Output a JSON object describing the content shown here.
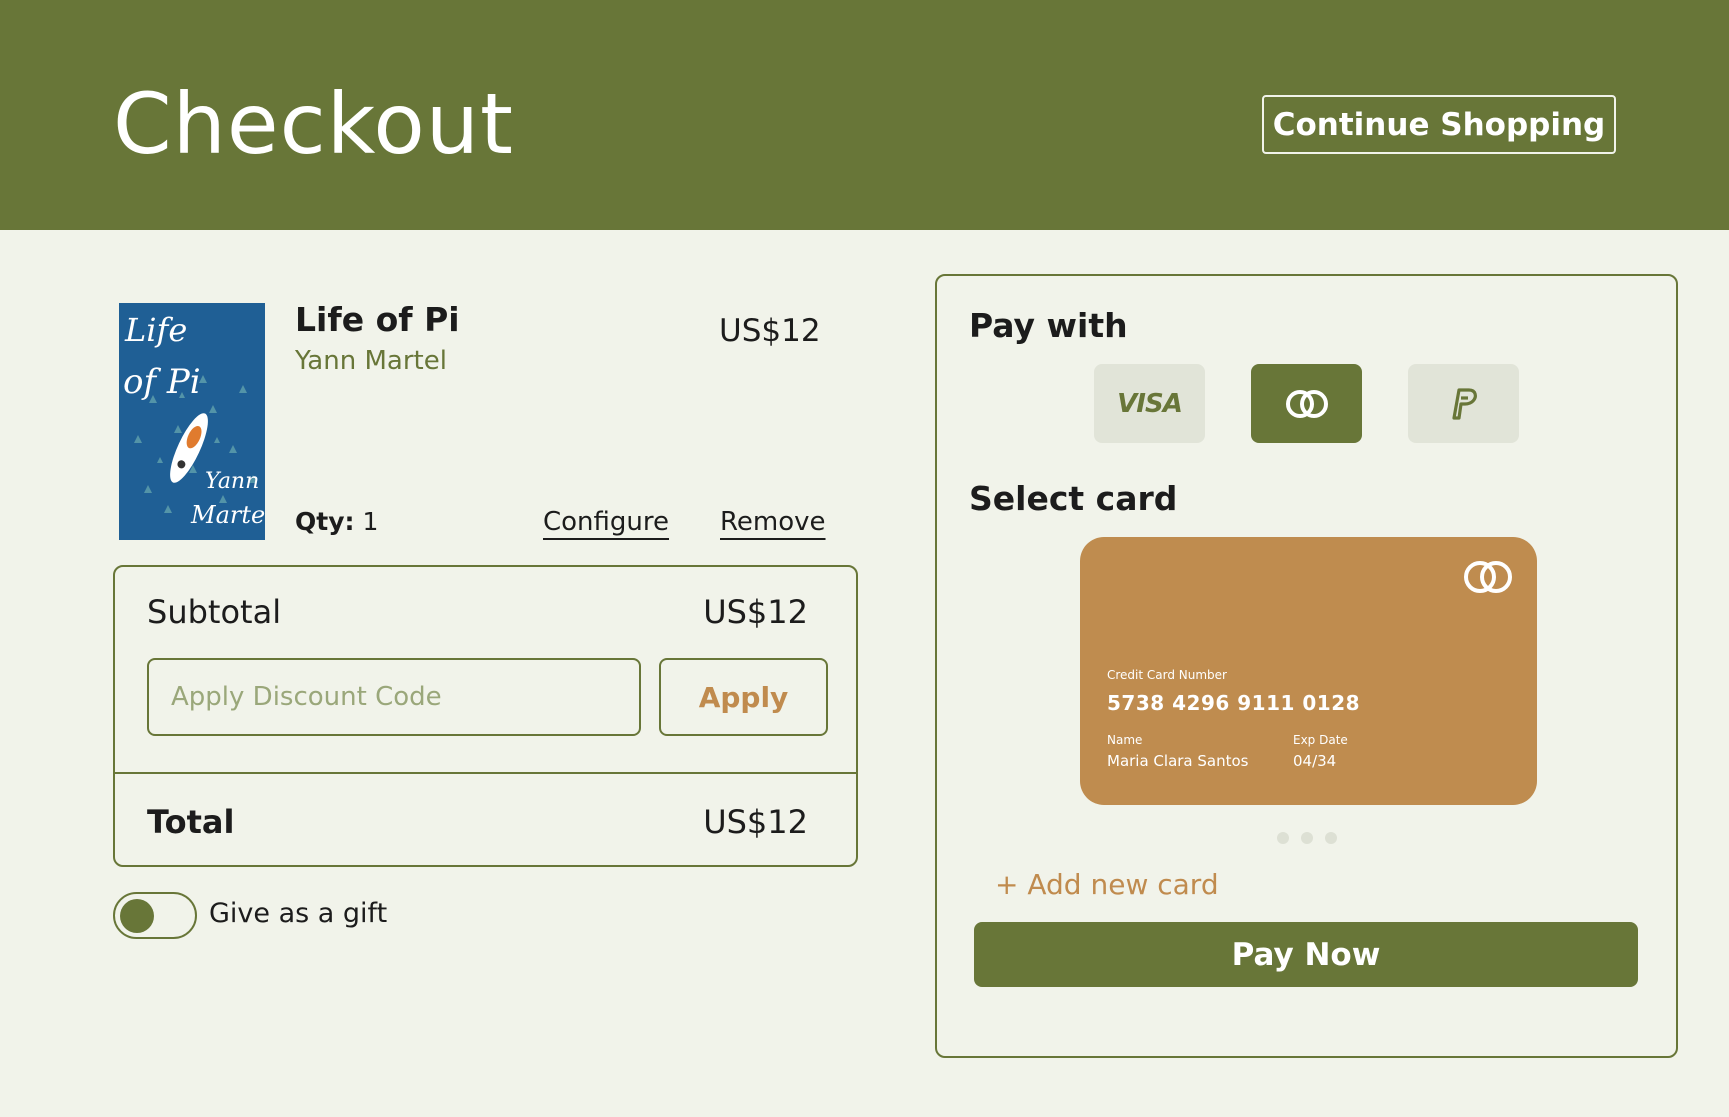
{
  "header": {
    "title": "Checkout",
    "continue_label": "Continue Shopping"
  },
  "product": {
    "cover_text": {
      "line1": "Life",
      "line2": "of Pi",
      "author1": "Yann",
      "author2": "Martel"
    },
    "title": "Life of Pi",
    "author": "Yann Martel",
    "price": "US$12",
    "qty_label": "Qty:",
    "qty_value": "1",
    "configure_label": "Configure",
    "remove_label": "Remove"
  },
  "summary": {
    "subtotal_label": "Subtotal",
    "subtotal_value": "US$12",
    "discount_placeholder": "Apply Discount Code",
    "apply_label": "Apply",
    "total_label": "Total",
    "total_value": "US$12"
  },
  "gift": {
    "label": "Give as a gift",
    "enabled": false
  },
  "payment": {
    "title": "Pay with",
    "methods": [
      {
        "name": "visa",
        "label": "VISA",
        "selected": false
      },
      {
        "name": "mastercard",
        "selected": true
      },
      {
        "name": "paypal",
        "selected": false
      }
    ],
    "select_card_title": "Select card",
    "card": {
      "number_label": "Credit Card Number",
      "number": "5738 4296 9111 0128",
      "name_label": "Name",
      "name": "Maria Clara Santos",
      "exp_label": "Exp Date",
      "exp": "04/34"
    },
    "add_card_label": "+ Add new card",
    "pay_now_label": "Pay Now"
  },
  "colors": {
    "brand_green": "#687638",
    "accent_tan": "#bf8c4f",
    "background": "#f1f3ea"
  }
}
